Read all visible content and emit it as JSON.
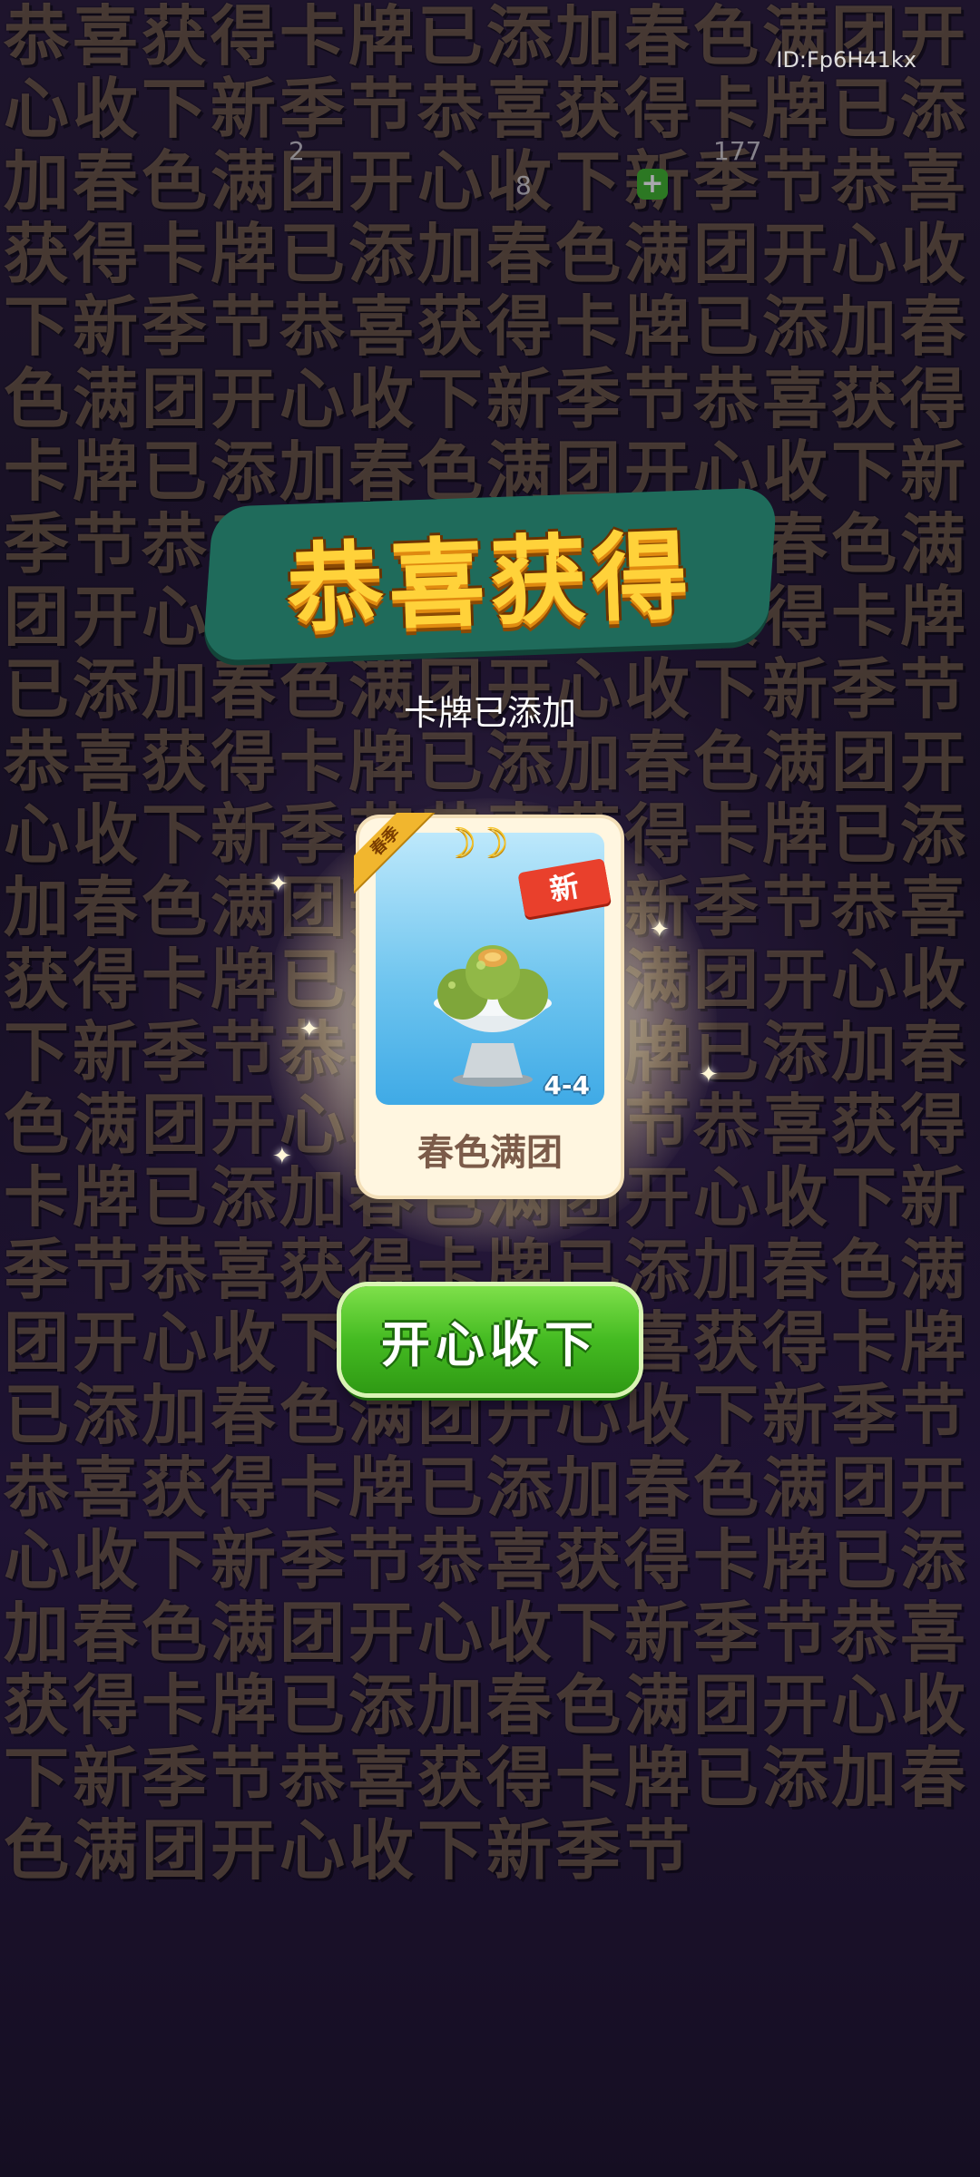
{
  "watermark_id": "ID:Fp6H41kx",
  "top_bar": {
    "counter_1": "2",
    "counter_2": "8",
    "counter_3": "177",
    "plus": "+"
  },
  "background_wall_text": "恭喜获得卡牌已添加春色满团开心收下新季节恭喜获得卡牌已添加春色满团开心收下新季节恭喜获得卡牌已添加春色满团开心收下新季节恭喜获得卡牌已添加春色满团开心收下新季节恭喜获得卡牌已添加春色满团开心收下新季节恭喜获得卡牌已添加春色满团开心收下新季节恭喜获得卡牌已添加春色满团开心收下新季节恭喜获得卡牌已添加春色满团开心收下新季节恭喜获得卡牌已添加春色满团开心收下新季节恭喜获得卡牌已添加春色满团开心收下新季节恭喜获得卡牌已添加春色满团开心收下新季节恭喜获得卡牌已添加春色满团开心收下新季节恭喜获得卡牌已添加春色满团开心收下新季节恭喜获得卡牌已添加春色满团开心收下新季节恭喜获得卡牌已添加春色满团开心收下新季节恭喜获得卡牌已添加春色满团开心收下新季节恭喜获得卡牌已添加春色满团开心收下新季节恭喜获得卡牌已添加春色满团开心收下新季节",
  "popup": {
    "title": "恭喜获得",
    "subtitle": "卡牌已添加",
    "card": {
      "season_tag": "春季",
      "moons": "☽☽",
      "new_badge": "新",
      "level": "4-4",
      "name": "春色满团"
    },
    "accept_button": "开心收下"
  },
  "colors": {
    "title_fill": "#ffd23a",
    "button_green": "#45bb22",
    "new_badge_red": "#e9402c",
    "card_bg": "#fff6e0"
  }
}
